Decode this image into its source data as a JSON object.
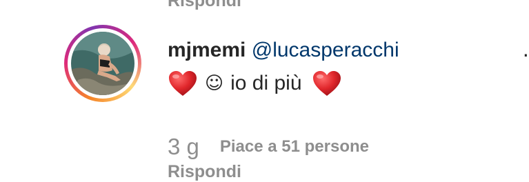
{
  "previous_comment": {
    "reply_label": "Rispondi"
  },
  "comment": {
    "username": "mjmemi",
    "mention": "@lucasperacchi",
    "emoji_left": "heart-emoji",
    "smile_glyph": "☺",
    "text": "io di più",
    "emoji_right": "heart-emoji",
    "time": "3 g",
    "likes": "Piace a 51 persone",
    "reply_label": "Rispondi"
  },
  "more_label": "·",
  "colors": {
    "primary_text": "#262626",
    "mention": "#00376b",
    "secondary_text": "#8e8e8e",
    "heart": "#e0262b",
    "story_ring": [
      "#f58529",
      "#dd2a7b",
      "#8134af",
      "#feda77"
    ]
  },
  "icons": {
    "heart": "heart-icon",
    "smile": "smile-icon",
    "more": "more-options-icon"
  }
}
